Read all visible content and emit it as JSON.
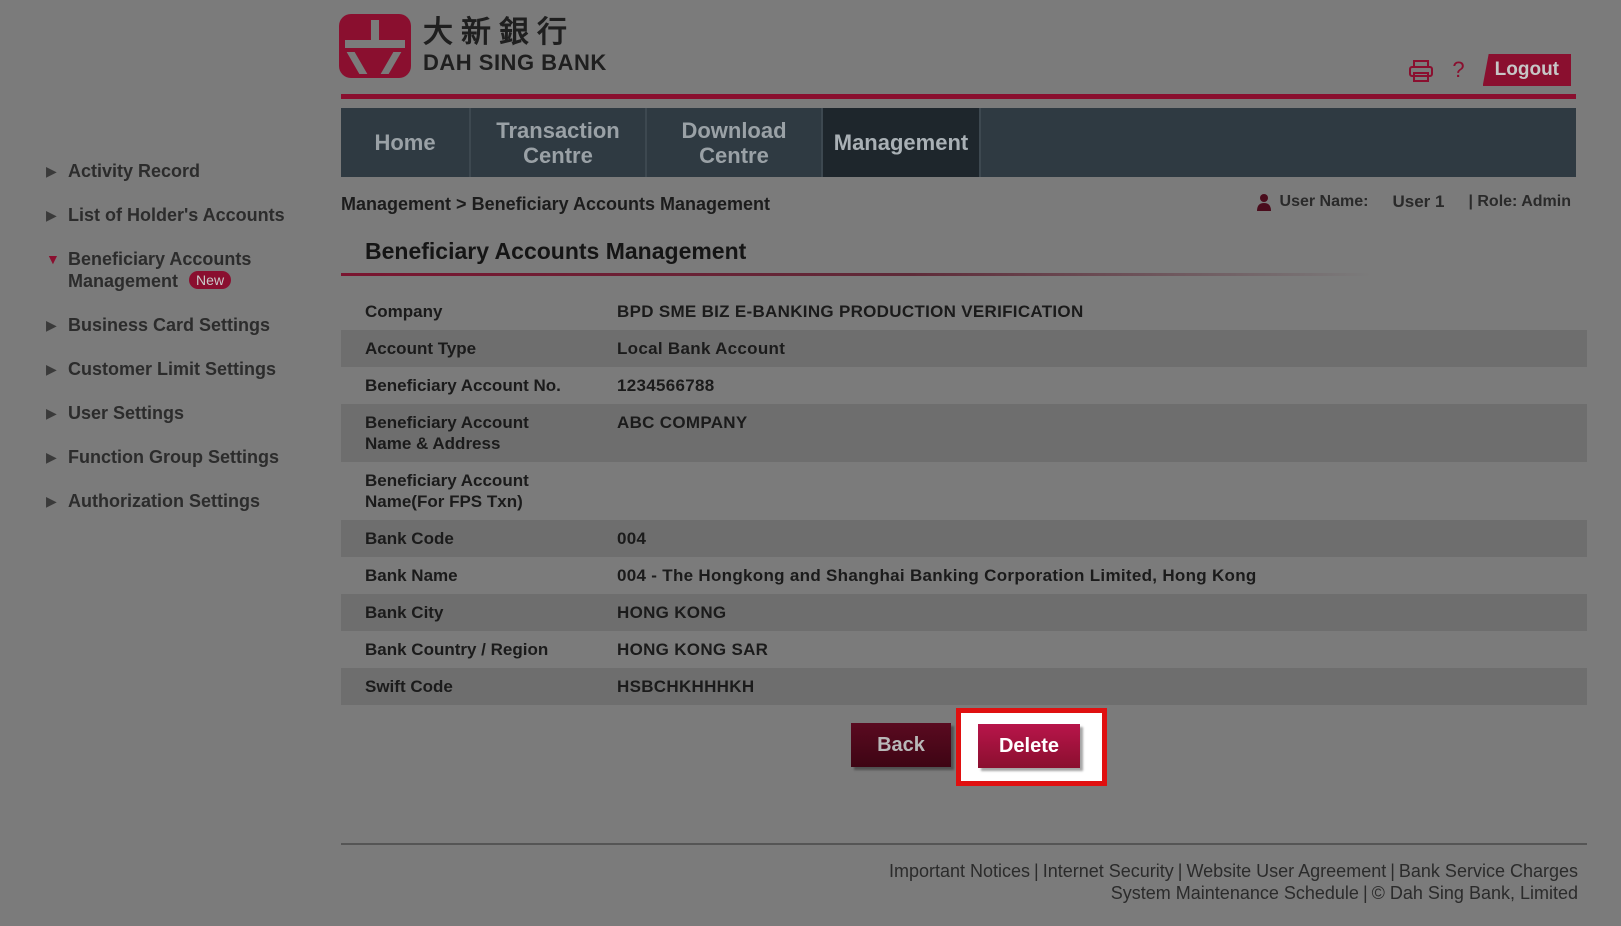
{
  "brand": {
    "name_cn": "大新銀行",
    "name_en": "DAH SING BANK"
  },
  "header": {
    "print_icon": "printer-icon",
    "help_icon": "question-icon",
    "help_label": "?",
    "logout_label": "Logout"
  },
  "sidebar": {
    "items": [
      {
        "label": "Activity Record",
        "active": false
      },
      {
        "label": "List of Holder's Accounts",
        "active": false
      },
      {
        "label": "Beneficiary Accounts Management",
        "active": true,
        "badge": "New"
      },
      {
        "label": "Business Card Settings",
        "active": false
      },
      {
        "label": "Customer Limit Settings",
        "active": false
      },
      {
        "label": "User Settings",
        "active": false
      },
      {
        "label": "Function Group Settings",
        "active": false
      },
      {
        "label": "Authorization Settings",
        "active": false
      }
    ]
  },
  "nav": {
    "items": [
      {
        "label": "Home"
      },
      {
        "label_line1": "Transaction",
        "label_line2": "Centre"
      },
      {
        "label_line1": "Download",
        "label_line2": "Centre"
      },
      {
        "label": "Management",
        "active": true
      }
    ]
  },
  "breadcrumb": {
    "parent": "Management",
    "separator": ">",
    "current": "Beneficiary Accounts Management"
  },
  "user": {
    "name_label": "User Name:",
    "name_value": "User 1",
    "role": "| Role: Admin"
  },
  "page": {
    "title": "Beneficiary Accounts Management"
  },
  "details": [
    {
      "label": "Company",
      "value": "BPD SME BIZ E-BANKING PRODUCTION VERIFICATION"
    },
    {
      "label": "Account Type",
      "value": "Local Bank Account"
    },
    {
      "label": "Beneficiary Account No.",
      "value": "1234566788"
    },
    {
      "label_line1": "Beneficiary Account",
      "label_line2": "Name & Address",
      "value": "ABC COMPANY"
    },
    {
      "label_line1": "Beneficiary Account",
      "label_line2": "Name(For FPS Txn)",
      "value": ""
    },
    {
      "label": "Bank Code",
      "value": "004"
    },
    {
      "label": "Bank Name",
      "value": "004 - The Hongkong and Shanghai Banking Corporation Limited, Hong Kong"
    },
    {
      "label": "Bank City",
      "value": "HONG KONG"
    },
    {
      "label": "Bank Country / Region",
      "value": "HONG KONG SAR"
    },
    {
      "label": "Swift Code",
      "value": "HSBCHKHHHKH"
    }
  ],
  "actions": {
    "back_label": "Back",
    "delete_label": "Delete"
  },
  "footer": {
    "links_line1": [
      "Important Notices",
      "Internet Security",
      "Website User Agreement",
      "Bank Service Charges"
    ],
    "maintenance": "System Maintenance Schedule",
    "copyright": "© Dah Sing Bank, Limited",
    "separator": "|"
  },
  "colors": {
    "brand": "#8a0f2f",
    "nav_bg": "#2f3a42",
    "highlight": "#e01010"
  }
}
